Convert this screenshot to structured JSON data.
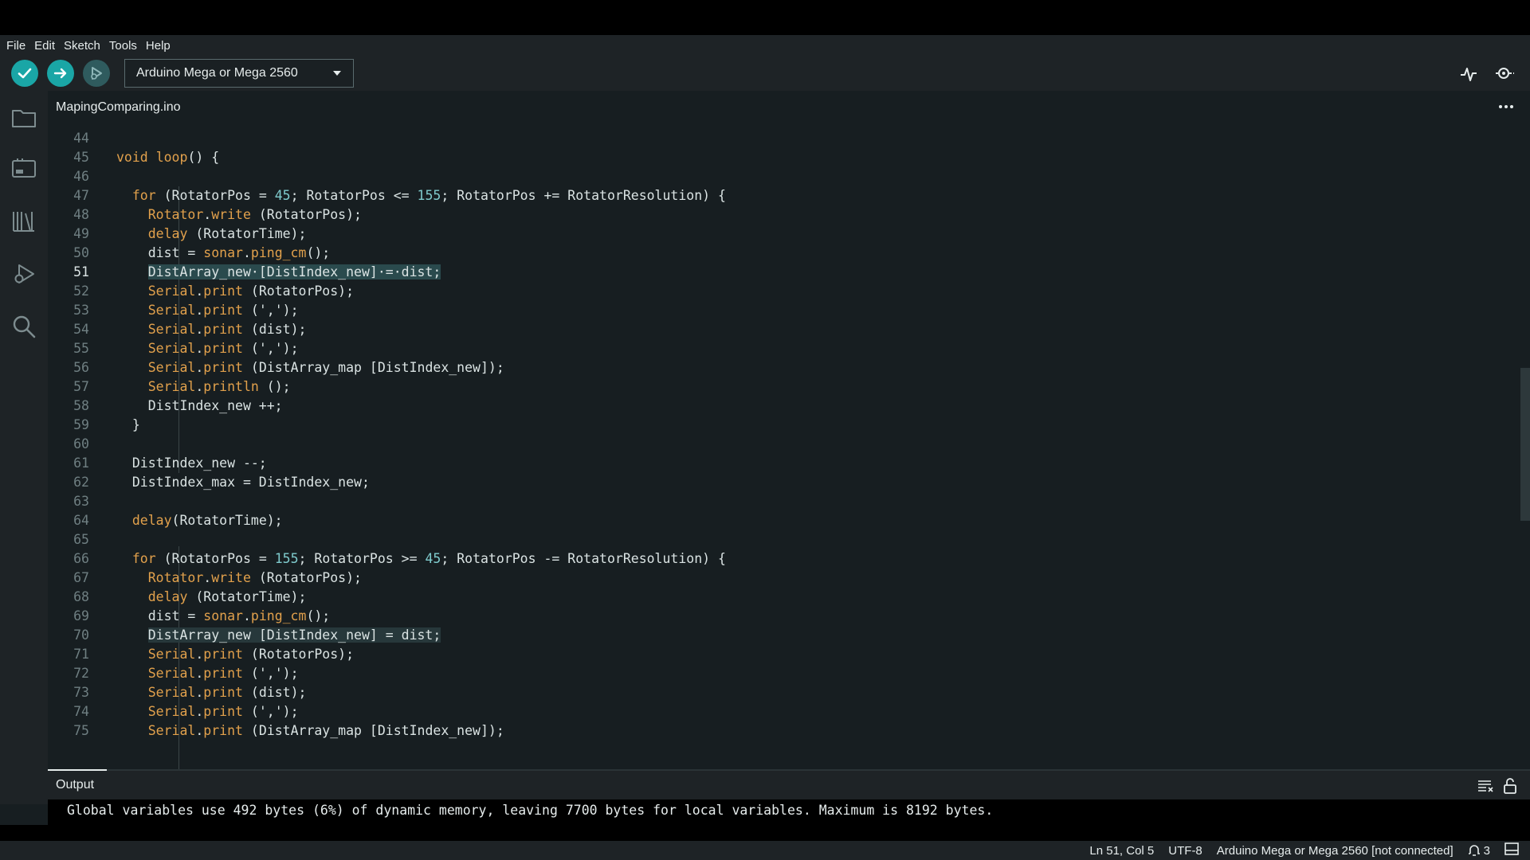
{
  "menu": [
    "File",
    "Edit",
    "Sketch",
    "Tools",
    "Help"
  ],
  "toolbar": {
    "verify_icon": "check-icon",
    "upload_icon": "arrow-right-icon",
    "debug_icon": "debug-icon",
    "board": "Arduino Mega or Mega 2560",
    "serial_plotter_icon": "pulse-icon",
    "serial_monitor_icon": "magnifier-dot-icon"
  },
  "sidebar": [
    "folder-icon",
    "board-icon",
    "library-icon",
    "debug-run-icon",
    "search-icon"
  ],
  "tab": {
    "label": "MapingComparing.ino",
    "more_icon": "ellipsis-icon"
  },
  "editor": {
    "active_line": "51",
    "lines": [
      {
        "n": "44",
        "t": ""
      },
      {
        "n": "45",
        "t": "void loop() {"
      },
      {
        "n": "46",
        "t": ""
      },
      {
        "n": "47",
        "t": "  for (RotatorPos = 45; RotatorPos <= 155; RotatorPos += RotatorResolution) {"
      },
      {
        "n": "48",
        "t": "    Rotator.write (RotatorPos);"
      },
      {
        "n": "49",
        "t": "    delay (RotatorTime);"
      },
      {
        "n": "50",
        "t": "    dist = sonar.ping_cm();"
      },
      {
        "n": "51",
        "t": "    DistArray_new·[DistIndex_new]·=·dist;"
      },
      {
        "n": "52",
        "t": "    Serial.print (RotatorPos);"
      },
      {
        "n": "53",
        "t": "    Serial.print (',');"
      },
      {
        "n": "54",
        "t": "    Serial.print (dist);"
      },
      {
        "n": "55",
        "t": "    Serial.print (',');"
      },
      {
        "n": "56",
        "t": "    Serial.print (DistArray_map [DistIndex_new]);"
      },
      {
        "n": "57",
        "t": "    Serial.println ();"
      },
      {
        "n": "58",
        "t": "    DistIndex_new ++;"
      },
      {
        "n": "59",
        "t": "  }"
      },
      {
        "n": "60",
        "t": ""
      },
      {
        "n": "61",
        "t": "  DistIndex_new --;"
      },
      {
        "n": "62",
        "t": "  DistIndex_max = DistIndex_new;"
      },
      {
        "n": "63",
        "t": ""
      },
      {
        "n": "64",
        "t": "  delay(RotatorTime);"
      },
      {
        "n": "65",
        "t": ""
      },
      {
        "n": "66",
        "t": "  for (RotatorPos = 155; RotatorPos >= 45; RotatorPos -= RotatorResolution) {"
      },
      {
        "n": "67",
        "t": "    Rotator.write (RotatorPos);"
      },
      {
        "n": "68",
        "t": "    delay (RotatorTime);"
      },
      {
        "n": "69",
        "t": "    dist = sonar.ping_cm();"
      },
      {
        "n": "70",
        "t": "    DistArray_new [DistIndex_new] = dist;"
      },
      {
        "n": "71",
        "t": "    Serial.print (RotatorPos);"
      },
      {
        "n": "72",
        "t": "    Serial.print (',');"
      },
      {
        "n": "73",
        "t": "    Serial.print (dist);"
      },
      {
        "n": "74",
        "t": "    Serial.print (',');"
      },
      {
        "n": "75",
        "t": "    Serial.print (DistArray_map [DistIndex_new]);"
      }
    ]
  },
  "output": {
    "title": "Output",
    "text": "Global variables use 492 bytes (6%) of dynamic memory, leaving 7700 bytes for local variables. Maximum is 8192 bytes.",
    "clear_icon": "clear-output-icon",
    "lock_icon": "unlock-icon"
  },
  "status": {
    "position": "Ln 51, Col 5",
    "encoding": "UTF-8",
    "board": "Arduino Mega or Mega 2560 [not connected]",
    "notifications": "3",
    "panel_icon": "panel-toggle-icon"
  }
}
